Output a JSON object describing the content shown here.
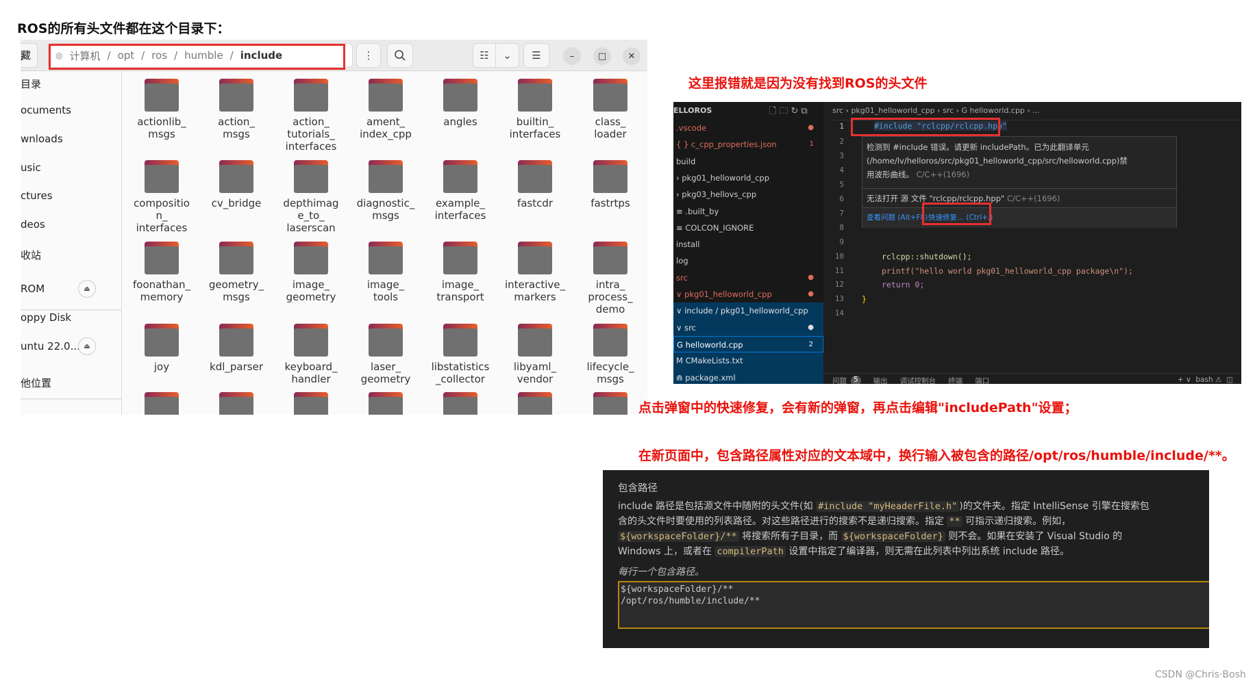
{
  "annotations": {
    "title": "ROS的所有头文件都在这个目录下：",
    "error_note": "这里报错就是因为没有找到ROS的头文件",
    "step1": "点击弹窗中的快速修复，会有新的弹窗，再点击编辑\"includePath\"设置；",
    "step2": "在新页面中，包含路径属性对应的文本域中，换行输入被包含的路径/opt/ros/humble/include/**。",
    "watermark": "CSDN @Chris·Bosh"
  },
  "file_manager": {
    "path": [
      "计算机",
      "opt",
      "ros",
      "humble",
      "include"
    ],
    "sidebar": [
      {
        "label": "藏"
      },
      {
        "label": "目录"
      },
      {
        "label": "ocuments"
      },
      {
        "label": "wnloads"
      },
      {
        "label": "usic"
      },
      {
        "label": "ctures"
      },
      {
        "label": "deos"
      },
      {
        "label": "收站"
      },
      {
        "label": "ROM",
        "eject": true
      },
      {
        "label": "oppy Disk"
      },
      {
        "label": "untu 22.0...",
        "eject": true
      },
      {
        "label": "他位置"
      }
    ],
    "folders": [
      "actionlib_\nmsgs",
      "action_\nmsgs",
      "action_\ntutorials_\ninterfaces",
      "ament_\nindex_cpp",
      "angles",
      "builtin_\ninterfaces",
      "class_\nloader",
      "compositio\nn_\ninterfaces",
      "cv_bridge",
      "depthimag\ne_to_\nlaserscan",
      "diagnostic_\nmsgs",
      "example_\ninterfaces",
      "fastcdr",
      "fastrtps",
      "foonathan_\nmemory",
      "geometry_\nmsgs",
      "image_\ngeometry",
      "image_\ntools",
      "image_\ntransport",
      "interactive_\nmarkers",
      "intra_\nprocess_\ndemo",
      "joy",
      "kdl_parser",
      "keyboard_\nhandler",
      "laser_\ngeometry",
      "libstatistics\n_collector",
      "libyaml_\nvendor",
      "lifecycle_\nmsgs",
      "",
      "",
      "",
      "",
      "",
      "",
      ""
    ],
    "icons": {
      "menu": "⋮",
      "search": "search-icon",
      "list": "☷",
      "dropdown": "⌄",
      "hamburger": "☰",
      "minimize": "–",
      "maximize": "□",
      "close": "✕"
    }
  },
  "vscode": {
    "explorer_title": "ELLOROS",
    "explorer": [
      {
        "label": ".vscode",
        "color": "#e06c5c",
        "badge": "●"
      },
      {
        "label": "{ } c_cpp_properties.json",
        "color": "#e06c5c",
        "badge": "1"
      },
      {
        "label": "build",
        "color": "#cccccc"
      },
      {
        "label": "› pkg01_helloworld_cpp",
        "color": "#cccccc"
      },
      {
        "label": "› pkg03_hellovs_cpp",
        "color": "#cccccc"
      },
      {
        "label": "≡ .built_by",
        "color": "#cccccc"
      },
      {
        "label": "≡ COLCON_IGNORE",
        "color": "#cccccc"
      },
      {
        "label": "install",
        "color": "#cccccc"
      },
      {
        "label": "log",
        "color": "#cccccc"
      },
      {
        "label": "src",
        "color": "#e06c5c",
        "badge": "●"
      },
      {
        "label": "∨ pkg01_helloworld_cpp",
        "color": "#e06c5c",
        "badge": "●"
      },
      {
        "label": "∨ include / pkg01_helloworld_cpp",
        "color": "#e0e0e0",
        "selected": true
      },
      {
        "label": "∨ src",
        "color": "#e0e0e0",
        "selected": true,
        "badge": "●"
      },
      {
        "label": "  G helloworld.cpp",
        "color": "#ffffff",
        "selected": true,
        "focused": true,
        "badge": "2"
      },
      {
        "label": "M CMakeLists.txt",
        "color": "#e0e0e0",
        "selected": true
      },
      {
        "label": "⋒ package.xml",
        "color": "#e0e0e0",
        "selected": true
      }
    ],
    "breadcrumb": "src › pkg01_helloworld_cpp › src › G helloworld.cpp › ...",
    "line_numbers": [
      "1",
      "2",
      "3",
      "4",
      "5",
      "6",
      "7",
      "8",
      "9",
      "10",
      "11",
      "12",
      "13",
      "14"
    ],
    "code": {
      "line1": "#include \"rclcpp/rclcpp.hpp\"",
      "line10": "rclcpp::shutdown();",
      "line11": "printf(\"hello world pkg01_helloworld_cpp package\\n\");",
      "line12": "return 0;",
      "line13": "}"
    },
    "hover": {
      "msg1_l1": "检测到 #include 错误。请更新 includePath。已为此翻译单元",
      "msg1_l2": "(/home/lv/helloros/src/pkg01_helloworld_cpp/src/helloworld.cpp)禁",
      "msg1_l3": "用波形曲线。",
      "msg1_src": "C/C++(1696)",
      "msg2": "无法打开 源 文件 \"rclcpp/rclcpp.hpp\"",
      "msg2_src": "C/C++(1696)",
      "view_problem": "查看问题 (Alt+F8)",
      "quick_fix": "快速修复... (Ctrl+.)"
    },
    "panel_tabs": [
      "问题",
      "输出",
      "调试控制台",
      "终端",
      "端口"
    ],
    "problems_count": "5",
    "panel_right": "+ ∨  bash ⚠  ◫"
  },
  "settings": {
    "title": "包含路径",
    "description": [
      [
        {
          "t": "include 路径是包括源文件中随附的头文件(如 "
        },
        {
          "t": "#include \"myHeaderFile.h\"",
          "code": true
        },
        {
          "t": ")的文件夹。指定 IntelliSense 引擎在搜索包"
        }
      ],
      [
        {
          "t": "含的头文件时要使用的列表路径。对这些路径进行的搜索不是递归搜索。指定 "
        },
        {
          "t": "**",
          "code": true
        },
        {
          "t": " 可指示递归搜索。例如，"
        }
      ],
      [
        {
          "t": "${workspaceFolder}/**",
          "code": true
        },
        {
          "t": " 将搜索所有子目录，而 "
        },
        {
          "t": "${workspaceFolder}",
          "code": true
        },
        {
          "t": " 则不会。如果在安装了 Visual Studio 的"
        }
      ],
      [
        {
          "t": "Windows 上，或者在 "
        },
        {
          "t": "compilerPath",
          "code": true
        },
        {
          "t": " 设置中指定了编译器，则无需在此列表中列出系统 include 路径。"
        }
      ]
    ],
    "hint": "每行一个包含路径。",
    "value": "${workspaceFolder}/**\n/opt/ros/humble/include/**"
  }
}
